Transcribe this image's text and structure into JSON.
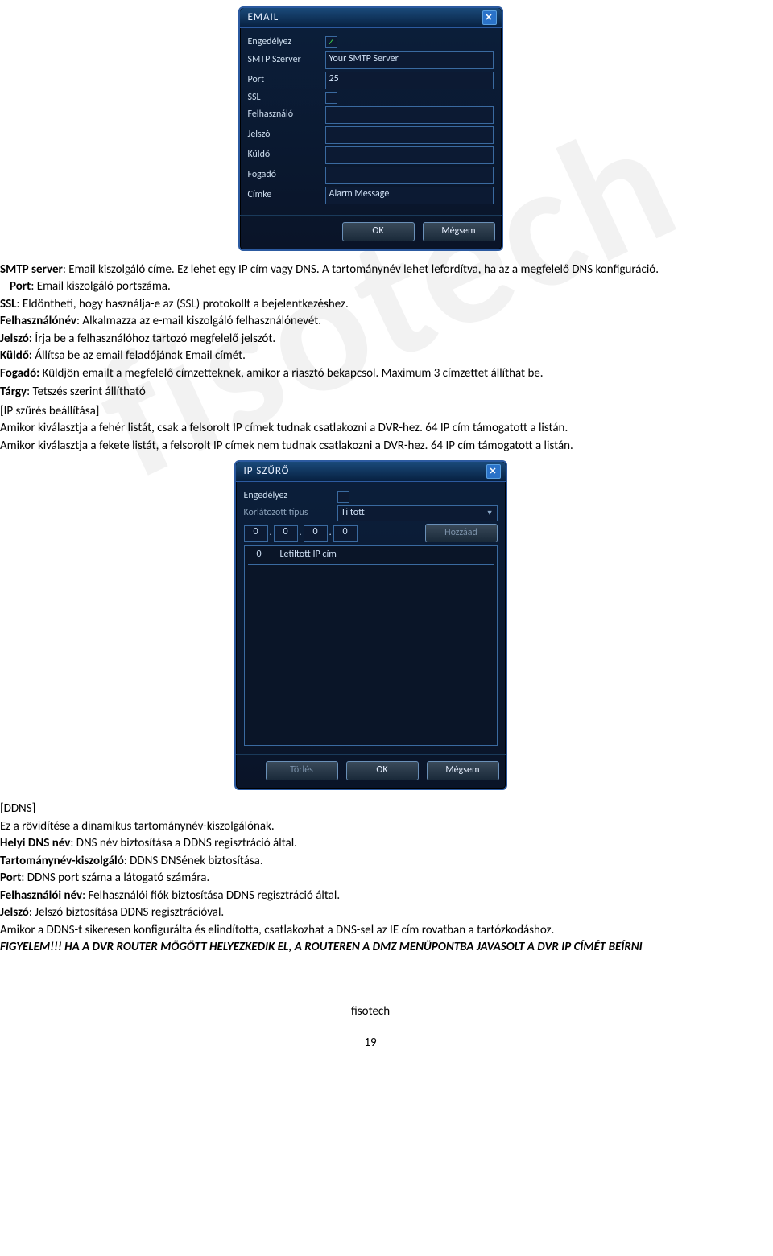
{
  "watermark": "fisotech",
  "email_dialog": {
    "title": "EMAIL",
    "fields": {
      "enable_label": "Engedélyez",
      "enable_checked": "✓",
      "smtp_label": "SMTP Szerver",
      "smtp_value": "Your SMTP Server",
      "port_label": "Port",
      "port_value": "25",
      "ssl_label": "SSL",
      "user_label": "Felhasználó",
      "user_value": "",
      "pass_label": "Jelszó",
      "pass_value": "",
      "sender_label": "Küldő",
      "sender_value": "",
      "receiver_label": "Fogadó",
      "receiver_value": "",
      "subject_label": "Címke",
      "subject_value": "Alarm Message"
    },
    "buttons": {
      "ok": "OK",
      "cancel": "Mégsem"
    }
  },
  "text1": {
    "smtp_b": "SMTP server",
    "smtp_rest": ": Email kiszolgáló címe. Ez lehet egy IP cím vagy DNS. A tartománynév lehet lefordítva, ha az a megfelelő DNS konfiguráció.",
    "port_b": "Port",
    "port_rest": ": Email kiszolgáló portszáma.",
    "ssl_b": "SSL",
    "ssl_rest": ": Eldöntheti, hogy használja-e az (SSL) protokollt a bejelentkezéshez.",
    "user_b": "Felhasználónév",
    "user_rest": ": Alkalmazza az e-mail kiszolgáló felhasználónevét.",
    "pass_b": "Jelszó:",
    "pass_rest": " Írja be a felhasználóhoz tartozó megfelelő jelszót.",
    "sender_b": "Küldő:",
    "sender_rest": " Állítsa be az email feladójának Email címét.",
    "rec_b": "Fogadó:",
    "rec_rest": " Küldjön emailt a megfelelő címzetteknek, amikor a riasztó bekapcsol. Maximum 3 címzettet állíthat be.",
    "subj_b": "Tárgy",
    "subj_rest": ": Tetszés szerint állítható",
    "ipfilter_heading": "[IP szűrés beállítása]",
    "ipf_white": "Amikor kiválasztja a fehér listát, csak a felsorolt IP címek tudnak csatlakozni a DVR-hez. 64 IP cím támogatott a listán.",
    "ipf_black": "Amikor kiválasztja a fekete listát, a felsorolt IP címek nem tudnak csatlakozni a DVR-hez. 64 IP cím támogatott a listán."
  },
  "ip_dialog": {
    "title": "IP SZŰRŐ",
    "enable_label": "Engedélyez",
    "type_label": "Korlátozott típus",
    "type_value": "Tiltott",
    "ip_segments": [
      "0",
      "0",
      "0",
      "0"
    ],
    "add_btn": "Hozzáad",
    "col0": "0",
    "col1": "Letiltott IP cím",
    "buttons": {
      "del": "Törlés",
      "ok": "OK",
      "cancel": "Mégsem"
    }
  },
  "text2": {
    "ddns_heading": "[DDNS]",
    "ddns_line": "Ez a rövidítése a dinamikus tartománynév-kiszolgálónak.",
    "local_b": "Helyi DNS név",
    "local_rest": ": DNS név biztosítása a DDNS regisztráció által.",
    "srv_b": "Tartománynév-kiszolgáló",
    "srv_rest": ": DDNS DNSének biztosítása.",
    "port_b": "Port",
    "port_rest": ": DDNS port száma a látogató számára.",
    "un_b": "Felhasználói név",
    "un_rest": ": Felhasználói fiók biztosítása DDNS regisztráció által.",
    "pw_b": "Jelszó",
    "pw_rest": ": Jelszó biztosítása DDNS regisztrációval.",
    "conn": "Amikor a DDNS-t sikeresen konfigurálta és elindította, csatlakozhat a DNS-sel az IE cím rovatban a tartózkodáshoz.",
    "warn": "FIGYELEM!!! HA A DVR ROUTER MÖGÖTT HELYEZKEDIK EL, A ROUTEREN A DMZ MENÜPONTBA JAVASOLT A DVR IP CÍMÉT BEÍRNI"
  },
  "footer": {
    "brand": "fisotech",
    "page": "19"
  }
}
